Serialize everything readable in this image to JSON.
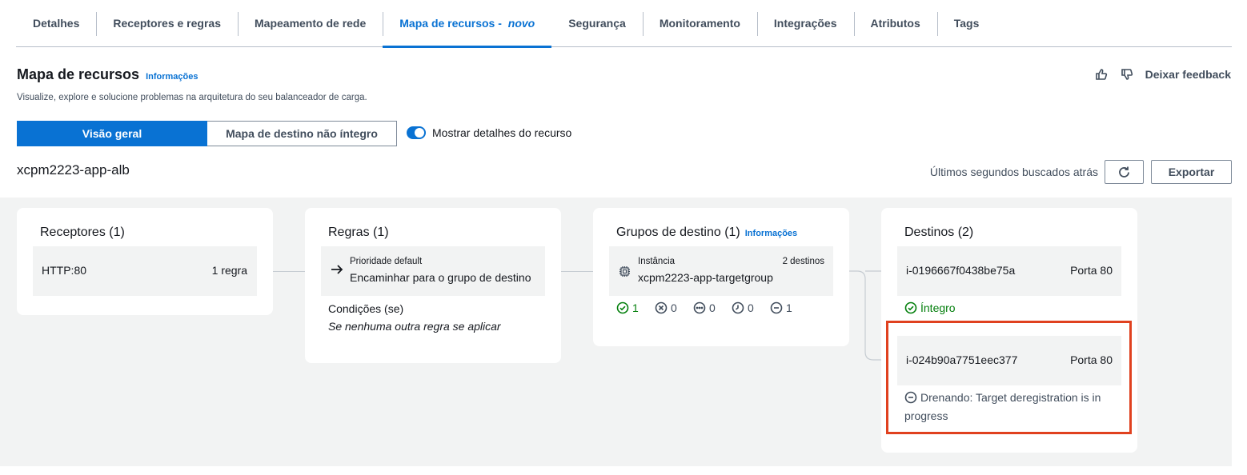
{
  "tabs": [
    {
      "label": "Detalhes"
    },
    {
      "label": "Receptores e regras"
    },
    {
      "label": "Mapeamento de rede"
    },
    {
      "label": "Mapa de recursos - ",
      "suffix": "novo",
      "active": true
    },
    {
      "label": "Segurança"
    },
    {
      "label": "Monitoramento"
    },
    {
      "label": "Integrações"
    },
    {
      "label": "Atributos"
    },
    {
      "label": "Tags"
    }
  ],
  "header": {
    "title": "Mapa de recursos",
    "info": "Informações",
    "description": "Visualize, explore e solucione problemas na arquitetura do seu balanceador de carga.",
    "feedback": "Deixar feedback"
  },
  "view": {
    "overview": "Visão geral",
    "unhealthy_map": "Mapa de destino não íntegro",
    "toggle_label": "Mostrar detalhes do recurso"
  },
  "lb": {
    "name": "xcpm2223-app-alb",
    "fetched": "Últimos segundos buscados atrás",
    "export": "Exportar"
  },
  "listeners": {
    "title": "Receptores (1)",
    "item": {
      "name": "HTTP:80",
      "rules": "1 regra"
    }
  },
  "rules": {
    "title": "Regras (1)",
    "priority": "Prioridade default",
    "action": "Encaminhar para o grupo de destino",
    "conditions_label": "Condições (se)",
    "conditions_value": "Se nenhuma outra regra se aplicar"
  },
  "target_groups": {
    "title": "Grupos de destino (1)",
    "info": "Informações",
    "type": "Instância",
    "name": "xcpm2223-app-targetgroup",
    "count": "2 destinos",
    "stats": {
      "healthy": "1",
      "unhealthy": "0",
      "unused": "0",
      "initial": "0",
      "draining": "1"
    }
  },
  "targets": {
    "title": "Destinos (2)",
    "items": [
      {
        "id": "i-0196667f0438be75a",
        "port": "Porta 80",
        "status": "Íntegro"
      },
      {
        "id": "i-024b90a7751eec377",
        "port": "Porta 80",
        "status_line1": "Drenando: Target deregistration is in",
        "status_line2": "progress"
      }
    ]
  },
  "colors": {
    "accent": "#0972d3",
    "healthy": "#037f0c",
    "highlight": "#e0411f"
  }
}
